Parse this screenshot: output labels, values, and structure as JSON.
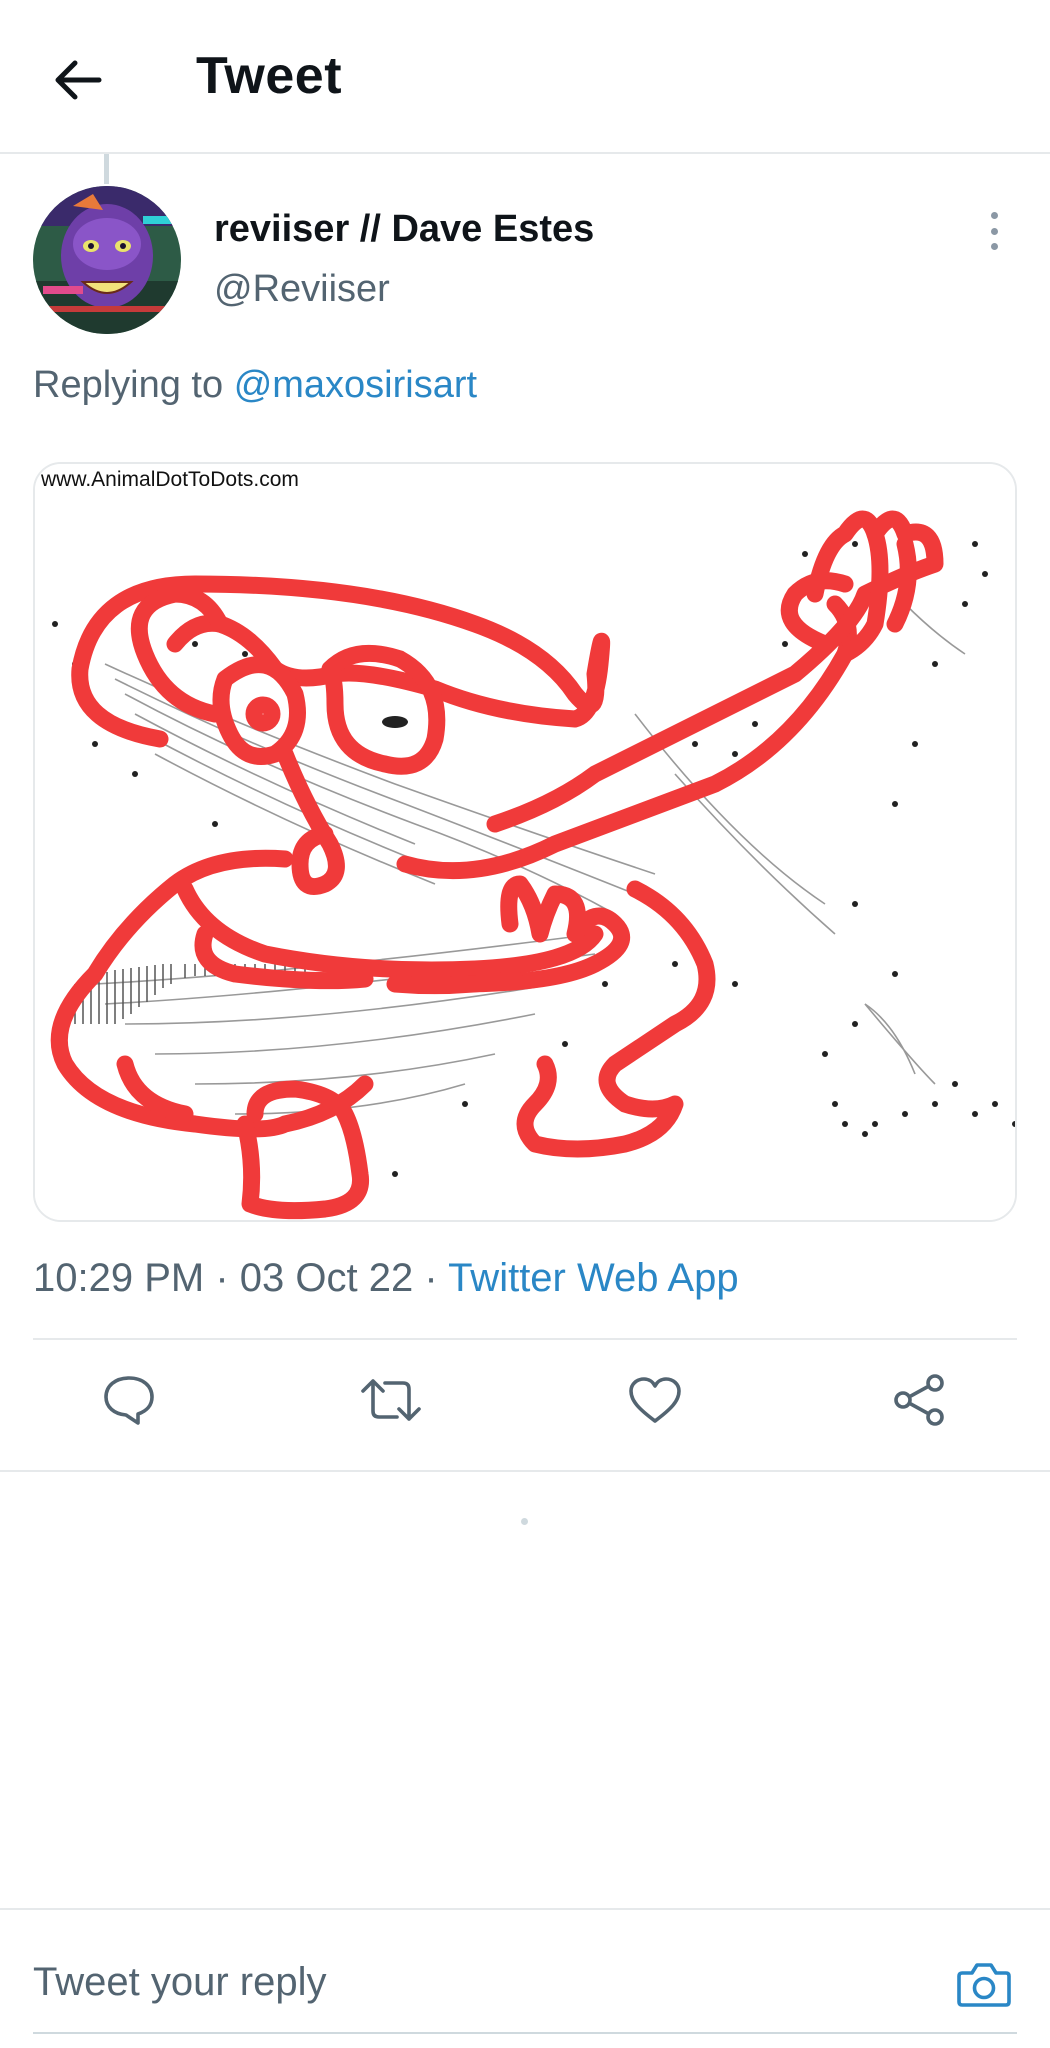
{
  "header": {
    "title": "Tweet",
    "back_icon": "arrow-left-icon"
  },
  "tweet": {
    "display_name": "reviiser // Dave Estes",
    "handle": "@Reviiser",
    "replying_prefix": "Replying to",
    "replying_to": "@maxosirisart",
    "media_watermark": "www.AnimalDotToDots.com",
    "time": "10:29 PM",
    "date": "03 Oct 22",
    "separator": "·",
    "source": "Twitter Web App"
  },
  "actions": [
    {
      "name": "reply",
      "icon": "reply-icon"
    },
    {
      "name": "retweet",
      "icon": "retweet-icon"
    },
    {
      "name": "like",
      "icon": "heart-icon"
    },
    {
      "name": "share",
      "icon": "share-icon"
    }
  ],
  "composer": {
    "placeholder": "Tweet your reply",
    "camera_icon": "camera-icon"
  },
  "colors": {
    "accent": "#2a87c6",
    "secondary_text": "#536471",
    "drawing_red": "#f03a3a"
  }
}
